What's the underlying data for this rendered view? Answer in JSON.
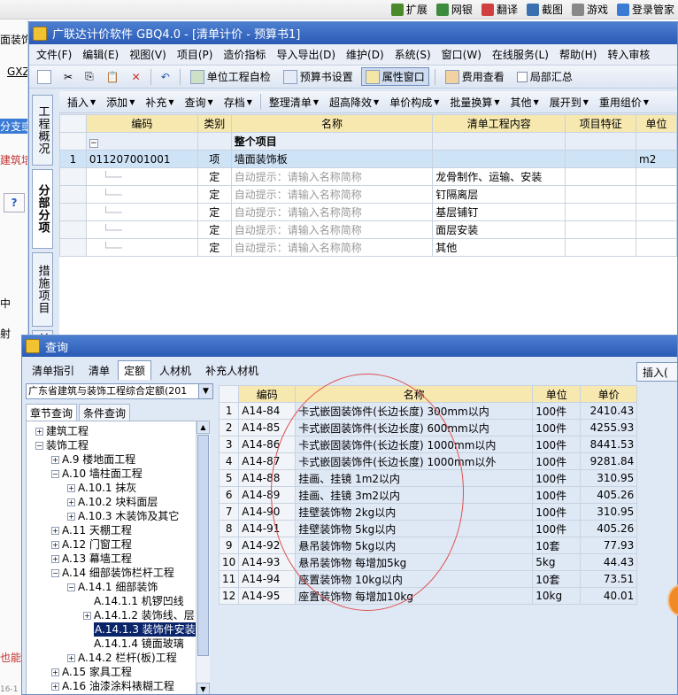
{
  "browser": {
    "items": [
      {
        "label": "扩展",
        "icon": "extensions-icon",
        "color": "#4a8a2a"
      },
      {
        "label": "网银",
        "icon": "bank-icon",
        "color": "#3d8c3d"
      },
      {
        "label": "翻译",
        "icon": "translate-icon",
        "color": "#d04040"
      },
      {
        "label": "截图",
        "icon": "screenshot-icon",
        "color": "#3a6fb0"
      },
      {
        "label": "游戏",
        "icon": "game-icon",
        "color": "#888888"
      },
      {
        "label": "登录管家",
        "icon": "login-manager-icon",
        "color": "#3a7bd5"
      }
    ]
  },
  "left_page": {
    "t1": "面装饰",
    "t2": "GXZ",
    "t3": "分支或",
    "t4": "建筑培训",
    "t5": "?",
    "t6": "中",
    "t7": "射",
    "t8": "也能",
    "t9": "16-1"
  },
  "app": {
    "title": "广联达计价软件 GBQ4.0 - [清单计价 - 预算书1]",
    "menus": [
      "文件(F)",
      "编辑(E)",
      "视图(V)",
      "项目(P)",
      "造价指标",
      "导入导出(D)",
      "维护(D)",
      "系统(S)",
      "窗口(W)",
      "在线服务(L)",
      "帮助(H)",
      "转入审核"
    ],
    "toolbar1": {
      "self_check": "单位工程自检",
      "book_settings": "预算书设置",
      "property_window": "属性窗口",
      "cost_view": "费用查看",
      "partial_summary": "局部汇总"
    },
    "toolbar2": [
      "插入",
      "添加",
      "补充",
      "查询",
      "存档",
      "整理清单",
      "超高降效",
      "单价构成",
      "批量换算",
      "其他",
      "展开到",
      "重用组价"
    ],
    "vtabs": [
      "工程概况",
      "分部分项",
      "措施项目",
      "其"
    ],
    "grid": {
      "headers": [
        "编码",
        "类别",
        "名称",
        "清单工程内容",
        "项目特征",
        "单位"
      ],
      "top_row": {
        "name": "整个项目"
      },
      "main_row": {
        "index": "1",
        "code": "011207001001",
        "type": "项",
        "name": "墙面装饰板",
        "unit": "m2"
      },
      "sub_rows": [
        {
          "type": "定",
          "hint": "自动提示：请输入名称简称",
          "content": "龙骨制作、运输、安装"
        },
        {
          "type": "定",
          "hint": "自动提示：请输入名称简称",
          "content": "钉隔离层"
        },
        {
          "type": "定",
          "hint": "自动提示：请输入名称简称",
          "content": "基层铺钉"
        },
        {
          "type": "定",
          "hint": "自动提示：请输入名称简称",
          "content": "面层安装"
        },
        {
          "type": "定",
          "hint": "自动提示：请输入名称简称",
          "content": "其他"
        }
      ]
    }
  },
  "query": {
    "title": "查询",
    "tabs": [
      "清单指引",
      "清单",
      "定额",
      "人材机",
      "补充人材机"
    ],
    "insert_label": "插入(",
    "library": "广东省建筑与装饰工程综合定额(201",
    "subtabs": [
      "章节查询",
      "条件查询"
    ],
    "tree": [
      {
        "label": "建筑工程",
        "level": 0,
        "toggle": "+"
      },
      {
        "label": "装饰工程",
        "level": 0,
        "toggle": "-"
      },
      {
        "label": "A.9 楼地面工程",
        "level": 1,
        "toggle": "+"
      },
      {
        "label": "A.10 墙柱面工程",
        "level": 1,
        "toggle": "-"
      },
      {
        "label": "A.10.1 抹灰",
        "level": 2,
        "toggle": "+"
      },
      {
        "label": "A.10.2 块料面层",
        "level": 2,
        "toggle": "+"
      },
      {
        "label": "A.10.3 木装饰及其它",
        "level": 2,
        "toggle": "+"
      },
      {
        "label": "A.11 天棚工程",
        "level": 1,
        "toggle": "+"
      },
      {
        "label": "A.12 门窗工程",
        "level": 1,
        "toggle": "+"
      },
      {
        "label": "A.13 幕墙工程",
        "level": 1,
        "toggle": "+"
      },
      {
        "label": "A.14 细部装饰栏杆工程",
        "level": 1,
        "toggle": "-"
      },
      {
        "label": "A.14.1 细部装饰",
        "level": 2,
        "toggle": "-"
      },
      {
        "label": "A.14.1.1 机锣凹线",
        "level": 3,
        "toggle": ""
      },
      {
        "label": "A.14.1.2 装饰线、层",
        "level": 3,
        "toggle": "+"
      },
      {
        "label": "A.14.1.3 装饰件安装",
        "level": 3,
        "toggle": "",
        "selected": true
      },
      {
        "label": "A.14.1.4 镜面玻璃",
        "level": 3,
        "toggle": ""
      },
      {
        "label": "A.14.2 栏杆(板)工程",
        "level": 2,
        "toggle": "+"
      },
      {
        "label": "A.15 家具工程",
        "level": 1,
        "toggle": "+"
      },
      {
        "label": "A.16 油漆涂料裱糊工程",
        "level": 1,
        "toggle": "+"
      }
    ],
    "grid": {
      "headers": [
        "编码",
        "名称",
        "单位",
        "单价"
      ],
      "rows": [
        {
          "idx": "1",
          "code": "A14-84",
          "name": "卡式嵌固装饰件(长边长度) 300mm以内",
          "unit": "100件",
          "price": "2410.43"
        },
        {
          "idx": "2",
          "code": "A14-85",
          "name": "卡式嵌固装饰件(长边长度) 600mm以内",
          "unit": "100件",
          "price": "4255.93"
        },
        {
          "idx": "3",
          "code": "A14-86",
          "name": "卡式嵌固装饰件(长边长度) 1000mm以内",
          "unit": "100件",
          "price": "8441.53"
        },
        {
          "idx": "4",
          "code": "A14-87",
          "name": "卡式嵌固装饰件(长边长度) 1000mm以外",
          "unit": "100件",
          "price": "9281.84"
        },
        {
          "idx": "5",
          "code": "A14-88",
          "name": "挂画、挂镜 1m2以内",
          "unit": "100件",
          "price": "310.95"
        },
        {
          "idx": "6",
          "code": "A14-89",
          "name": "挂画、挂镜 3m2以内",
          "unit": "100件",
          "price": "405.26"
        },
        {
          "idx": "7",
          "code": "A14-90",
          "name": "挂壁装饰物 2kg以内",
          "unit": "100件",
          "price": "310.95"
        },
        {
          "idx": "8",
          "code": "A14-91",
          "name": "挂壁装饰物 5kg以内",
          "unit": "100件",
          "price": "405.26"
        },
        {
          "idx": "9",
          "code": "A14-92",
          "name": "悬吊装饰物 5kg以内",
          "unit": "10套",
          "price": "77.93"
        },
        {
          "idx": "10",
          "code": "A14-93",
          "name": "悬吊装饰物 每增加5kg",
          "unit": "5kg",
          "price": "44.43"
        },
        {
          "idx": "11",
          "code": "A14-94",
          "name": "座置装饰物 10kg以内",
          "unit": "10套",
          "price": "73.51"
        },
        {
          "idx": "12",
          "code": "A14-95",
          "name": "座置装饰物 每增加10kg",
          "unit": "10kg",
          "price": "40.01"
        }
      ]
    }
  }
}
